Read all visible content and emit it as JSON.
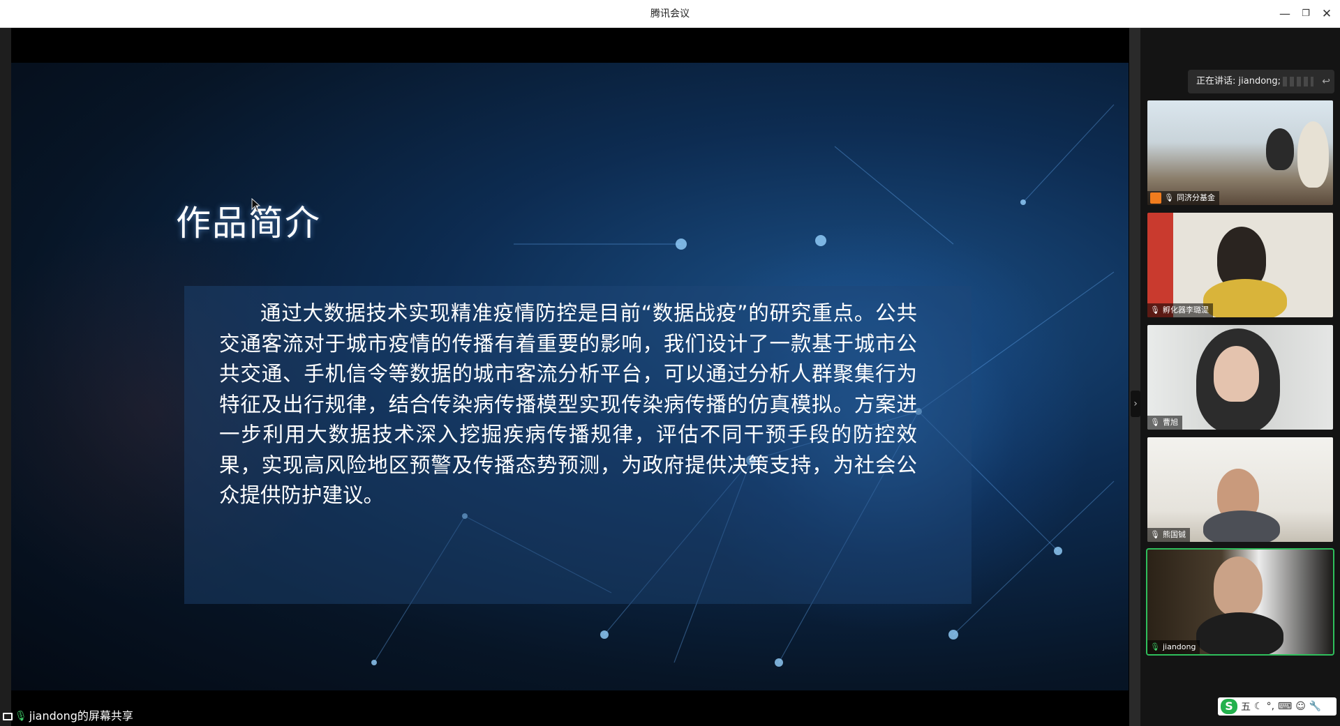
{
  "window": {
    "title": "腾讯会议",
    "minimize_glyph": "—",
    "restore_glyph": "❐",
    "close_glyph": "✕"
  },
  "slide": {
    "title": "作品简介",
    "body": "通过大数据技术实现精准疫情防控是目前“数据战疫”的研究重点。公共交通客流对于城市疫情的传播有着重要的影响，我们设计了一款基于城市公共交通、手机信令等数据的城市客流分析平台，可以通过分析人群聚集行为特征及出行规律，结合传染病传播模型实现传染病传播的仿真模拟。方案进一步利用大数据技术深入挖掘疾病传播规律，评估不同干预手段的防控效果，实现高风险地区预警及传播态势预测，为政府提供决策支持，为社会公众提供防护建议。"
  },
  "share_label": "jiandong的屏幕共享",
  "speaking": {
    "text": "正在讲话: jiandong;"
  },
  "participants": [
    {
      "name": "同济分基金",
      "host": true
    },
    {
      "name": "孵化器李璐湜",
      "host": false
    },
    {
      "name": "曹旭",
      "host": false
    },
    {
      "name": "熊国铖",
      "host": false
    },
    {
      "name": "jiandong",
      "host": false
    }
  ],
  "ime": {
    "logo": "S",
    "mode": "五",
    "icons": [
      "☾",
      "°,",
      "⌨",
      "☺",
      "🔧"
    ]
  },
  "colors": {
    "active_speaker_border": "#2fbf5c",
    "mic_active": "#3fd16a",
    "host_badge": "#f07c1e"
  }
}
